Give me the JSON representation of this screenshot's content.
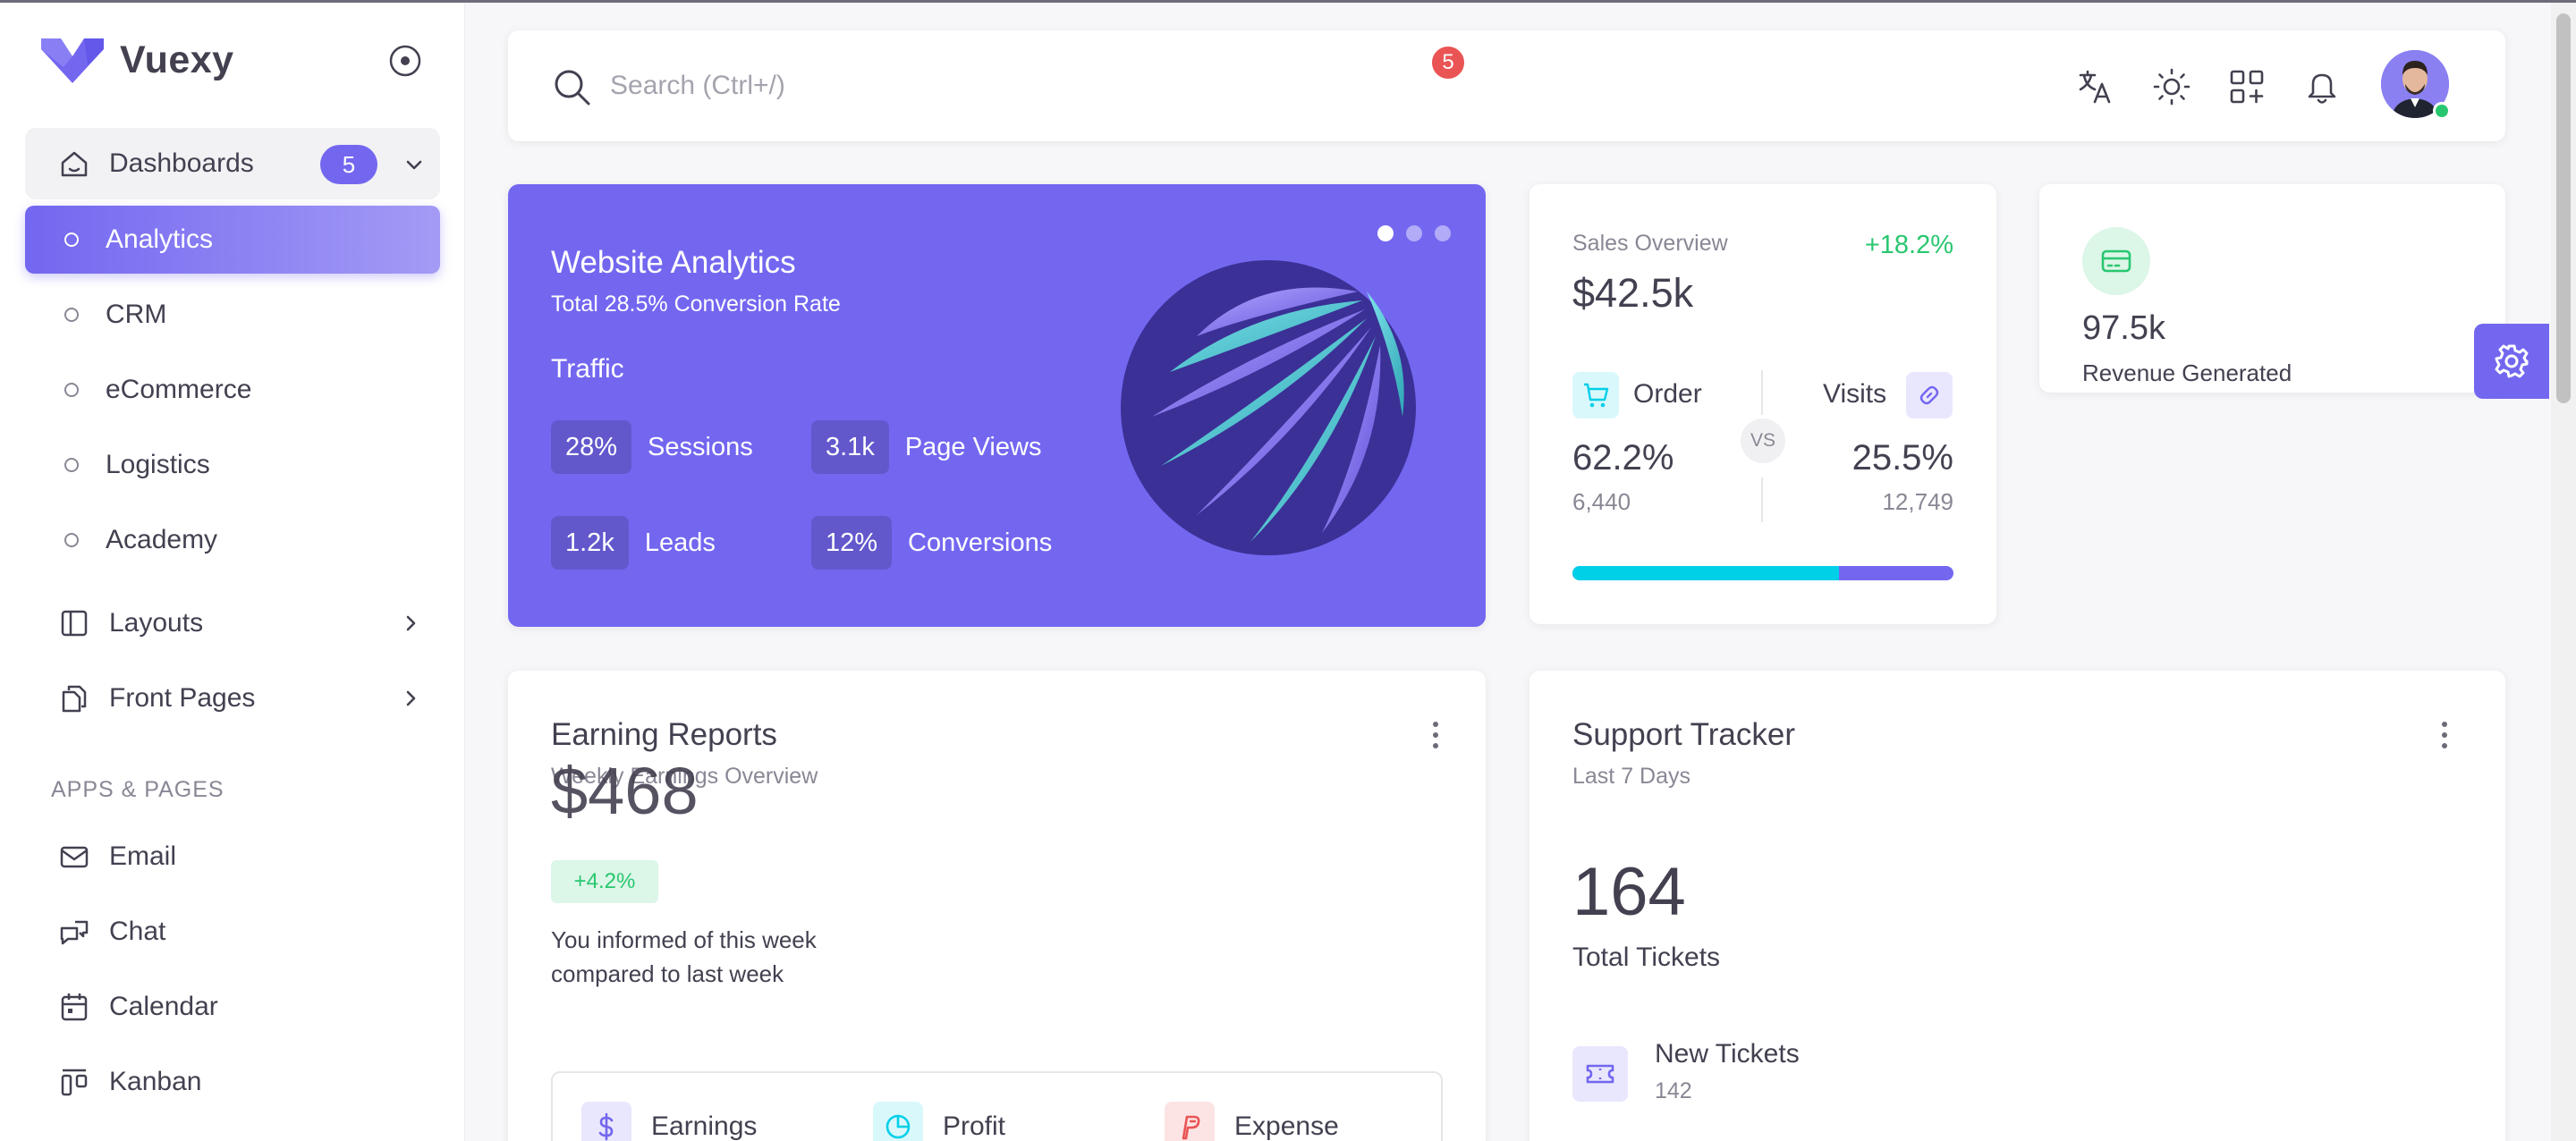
{
  "brand": {
    "name": "Vuexy"
  },
  "sidebar": {
    "dashboards": {
      "label": "Dashboards",
      "badge": "5"
    },
    "sub_items": [
      {
        "label": "Analytics",
        "active": true
      },
      {
        "label": "CRM"
      },
      {
        "label": "eCommerce"
      },
      {
        "label": "Logistics"
      },
      {
        "label": "Academy"
      }
    ],
    "layouts": "Layouts",
    "front_pages": "Front Pages",
    "section_header": "APPS & PAGES",
    "apps": [
      "Email",
      "Chat",
      "Calendar",
      "Kanban"
    ]
  },
  "navbar": {
    "search_placeholder": "Search (Ctrl+/)",
    "notification_count": "5",
    "icons": [
      "translate-icon",
      "sun-icon",
      "grid-plus-icon",
      "bell-icon"
    ]
  },
  "website_analytics": {
    "title": "Website Analytics",
    "subtitle": "Total 28.5% Conversion Rate",
    "traffic_label": "Traffic",
    "stats": [
      {
        "value": "28%",
        "label": "Sessions"
      },
      {
        "value": "3.1k",
        "label": "Page Views"
      },
      {
        "value": "1.2k",
        "label": "Leads"
      },
      {
        "value": "12%",
        "label": "Conversions"
      }
    ]
  },
  "sales_overview": {
    "title": "Sales Overview",
    "growth": "+18.2%",
    "value": "$42.5k",
    "order": {
      "label": "Order",
      "pct": "62.2%",
      "count": "6,440"
    },
    "visits": {
      "label": "Visits",
      "pct": "25.5%",
      "count": "12,749"
    },
    "vs": "VS",
    "order_share": 0.7
  },
  "revenue": {
    "value": "97.5k",
    "label": "Revenue Generated"
  },
  "earning_reports": {
    "title": "Earning Reports",
    "subtitle": "Weekly Earnings Overview",
    "amount": "$468",
    "badge": "+4.2%",
    "description": "You informed of this week compared to last week",
    "items": [
      "Earnings",
      "Profit",
      "Expense"
    ]
  },
  "support_tracker": {
    "title": "Support Tracker",
    "subtitle": "Last 7 Days",
    "total": "164",
    "total_label": "Total Tickets",
    "new_label": "New Tickets",
    "new_count": "142"
  },
  "colors": {
    "primary": "#7367f0",
    "success": "#28c76f",
    "info": "#00cfe8",
    "danger": "#ea5455"
  }
}
